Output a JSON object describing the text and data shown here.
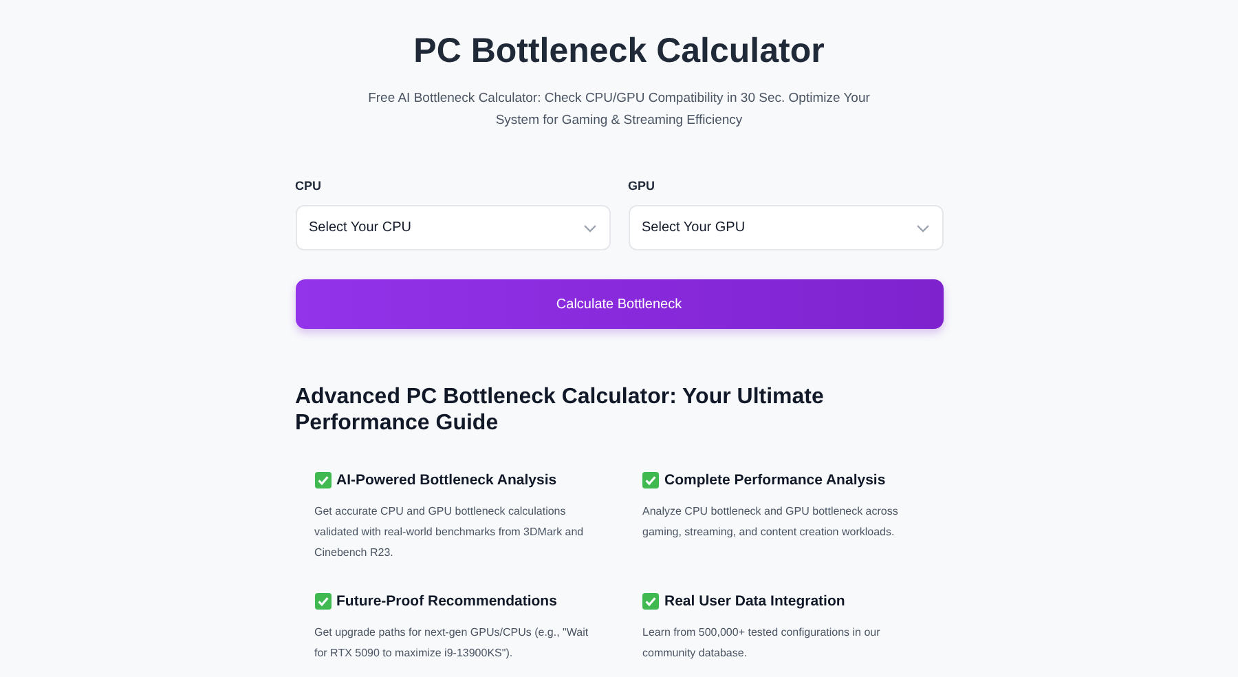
{
  "header": {
    "title": "PC Bottleneck Calculator",
    "subtitle": "Free AI Bottleneck Calculator: Check CPU/GPU Compatibility in 30 Sec. Optimize Your System for Gaming & Streaming Efficiency"
  },
  "selectors": [
    {
      "label": "CPU",
      "placeholder": "Select Your CPU"
    },
    {
      "label": "GPU",
      "placeholder": "Select Your GPU"
    }
  ],
  "calculate_button": "Calculate Bottleneck",
  "guide": {
    "heading": "Advanced PC Bottleneck Calculator: Your Ultimate Performance Guide",
    "features": [
      {
        "title": "AI-Powered Bottleneck Analysis",
        "description": "Get accurate CPU and GPU bottleneck calculations validated with real-world benchmarks from 3DMark and Cinebench R23."
      },
      {
        "title": "Complete Performance Analysis",
        "description": "Analyze CPU bottleneck and GPU bottleneck across gaming, streaming, and content creation workloads."
      },
      {
        "title": "Future-Proof Recommendations",
        "description": "Get upgrade paths for next-gen GPUs/CPUs (e.g., \"Wait for RTX 5090 to maximize i9-13900KS\")."
      },
      {
        "title": "Real User Data Integration",
        "description": "Learn from 500,000+ tested configurations in our community database."
      }
    ]
  }
}
